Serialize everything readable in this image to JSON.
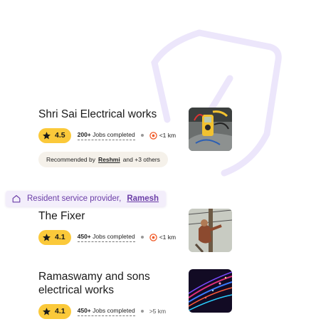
{
  "listings": [
    {
      "title": "Shri Sai Electrical works",
      "rating": "4.5",
      "jobs_count": "200+",
      "jobs_label": "Jobs completed",
      "distance": "<1 km",
      "recommendation": {
        "prefix": "Recommended by",
        "name": "Reshmi",
        "suffix": "and +3 others"
      }
    },
    {
      "title": "The Fixer",
      "rating": "4.1",
      "jobs_count": "450+",
      "jobs_label": "Jobs completed",
      "distance": "<1 km"
    },
    {
      "title": "Ramaswamy and sons electrical works",
      "rating": "4.1",
      "jobs_count": "450+",
      "jobs_label": "Jobs completed",
      "distance": ">5 km"
    }
  ],
  "resident_banner": {
    "label": "Resident service provider,",
    "name": "Ramesh"
  },
  "colors": {
    "rating_bg": "#fbc93a",
    "accent_orange": "#f05a28",
    "banner_purple": "#6b3ea7",
    "shield_watermark": "#ece6fb"
  },
  "icons": [
    "shield-icon",
    "star-icon",
    "target-icon",
    "home-icon"
  ]
}
